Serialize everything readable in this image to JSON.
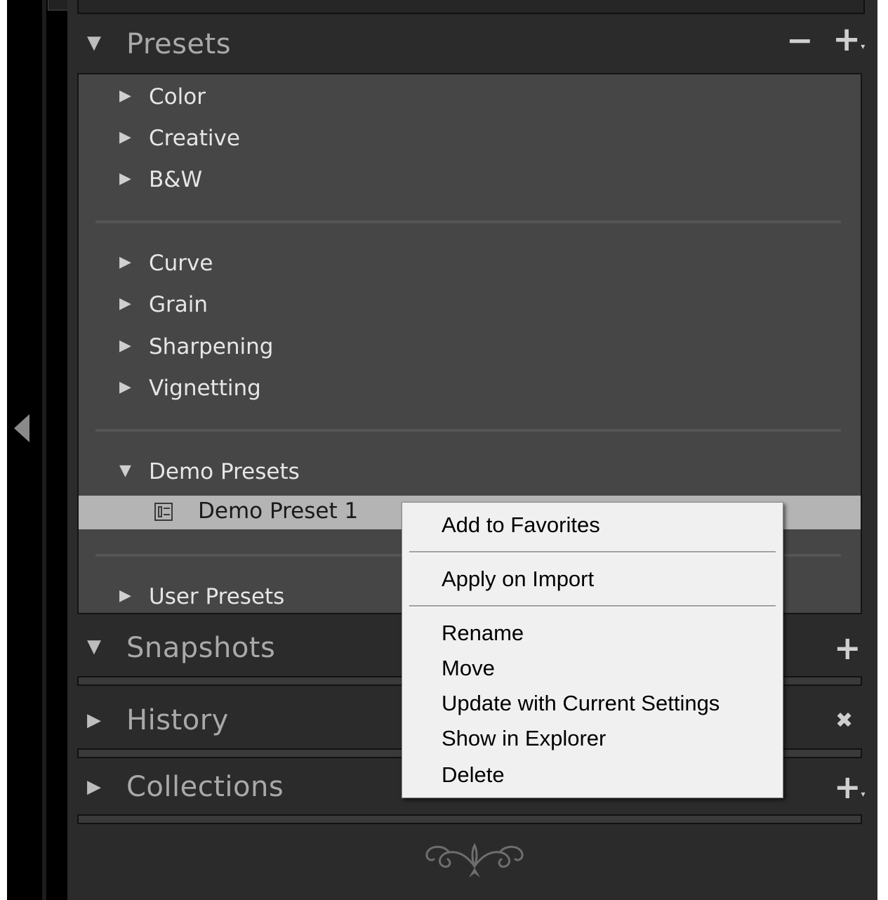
{
  "presets_panel": {
    "title": "Presets",
    "minus_glyph": "−",
    "add_glyph": "+",
    "groups": [
      [
        "Color",
        "Creative",
        "B&W"
      ],
      [
        "Curve",
        "Grain",
        "Sharpening",
        "Vignetting"
      ]
    ],
    "expanded_folder": {
      "label": "Demo Presets",
      "children": [
        "Demo Preset 1"
      ]
    },
    "user_presets": "User Presets"
  },
  "snapshots_panel": {
    "title": "Snapshots",
    "add_glyph": "+"
  },
  "history_panel": {
    "title": "History",
    "clear_glyph": "✖"
  },
  "collections_panel": {
    "title": "Collections",
    "add_glyph": "+"
  },
  "context_menu": {
    "items": [
      "Add to Favorites",
      "Apply on Import",
      "Rename",
      "Move",
      "Update with Current Settings",
      "Show in Explorer",
      "Delete"
    ]
  },
  "icons": {
    "expanded": "triangle-down-icon",
    "collapsed": "triangle-right-icon",
    "preset": "preset-file-icon",
    "panel_collapse": "panel-collapse-left-icon",
    "ornament": "panel-end-ornament-icon"
  },
  "colors": {
    "panel_bg": "#2b2b2b",
    "presets_body_bg": "#464646",
    "selected_row": "#b4b4b4",
    "menu_bg": "#f0f0f0",
    "header_text": "#a9a9a9"
  }
}
